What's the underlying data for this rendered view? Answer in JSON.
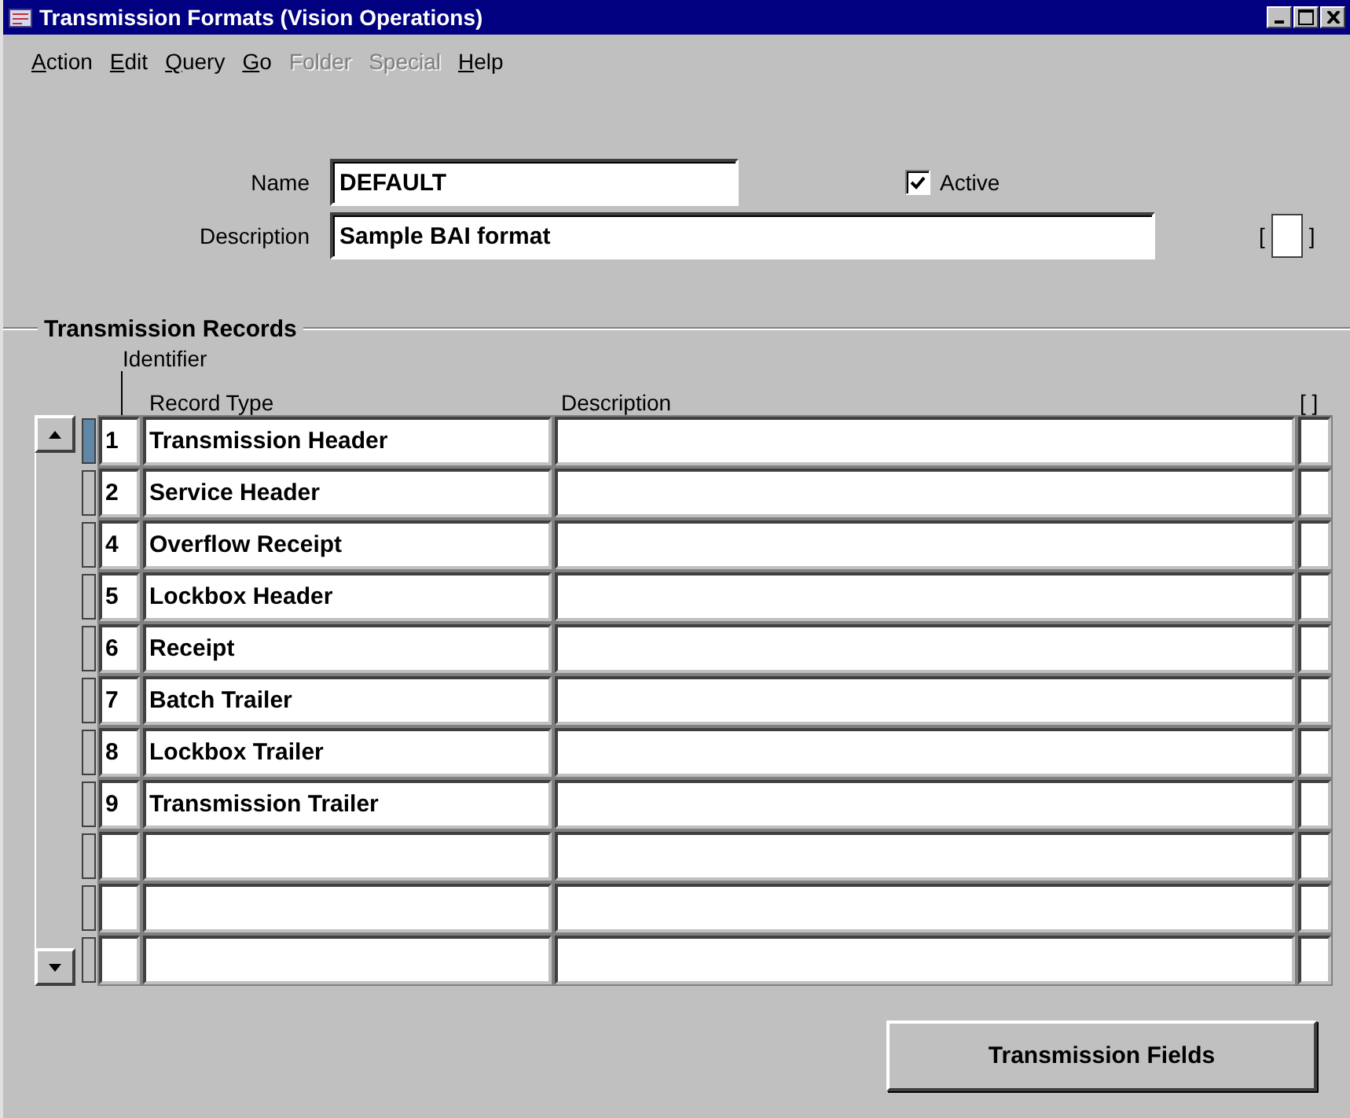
{
  "window": {
    "title": "Transmission Formats (Vision Operations)"
  },
  "menu": [
    {
      "label": "Action",
      "disabled": false
    },
    {
      "label": "Edit",
      "disabled": false
    },
    {
      "label": "Query",
      "disabled": false
    },
    {
      "label": "Go",
      "disabled": false
    },
    {
      "label": "Folder",
      "disabled": true
    },
    {
      "label": "Special",
      "disabled": true
    },
    {
      "label": "Help",
      "disabled": false
    }
  ],
  "header": {
    "name_label": "Name",
    "name_value": "DEFAULT",
    "active_label": "Active",
    "active_checked": true,
    "description_label": "Description",
    "description_value": "Sample BAI format",
    "flex_open": "[",
    "flex_close": "]"
  },
  "records": {
    "title": "Transmission Records",
    "identifier_header": "Identifier",
    "record_type_header": "Record Type",
    "description_header": "Description",
    "flex_header": "[ ]",
    "rows": [
      {
        "selected": true,
        "identifier": "1",
        "record_type": "Transmission Header"
      },
      {
        "selected": false,
        "identifier": "2",
        "record_type": "Service Header"
      },
      {
        "selected": false,
        "identifier": "4",
        "record_type": "Overflow Receipt"
      },
      {
        "selected": false,
        "identifier": "5",
        "record_type": "Lockbox Header"
      },
      {
        "selected": false,
        "identifier": "6",
        "record_type": "Receipt"
      },
      {
        "selected": false,
        "identifier": "7",
        "record_type": "Batch Trailer"
      },
      {
        "selected": false,
        "identifier": "8",
        "record_type": "Lockbox Trailer"
      },
      {
        "selected": false,
        "identifier": "9",
        "record_type": "Transmission Trailer"
      },
      {
        "selected": false
      },
      {
        "selected": false
      },
      {
        "selected": false
      }
    ]
  },
  "buttons": [
    "Transmission Fields"
  ]
}
